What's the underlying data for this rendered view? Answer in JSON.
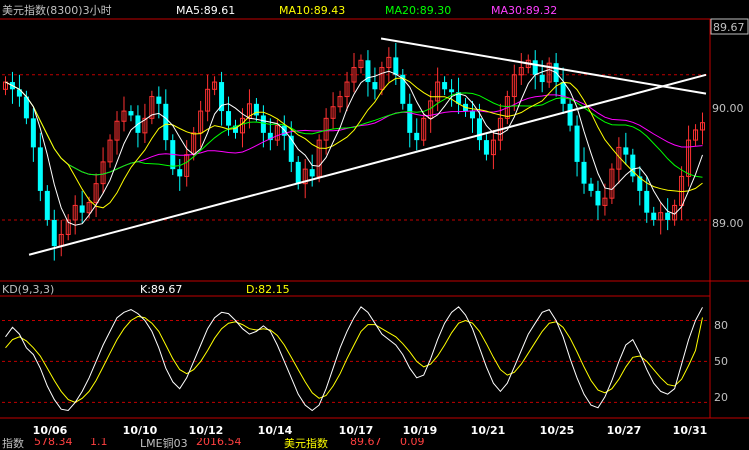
{
  "main_panel": {
    "title": "美元指数(8300)3小时",
    "ma5_label": "MA5:89.61",
    "ma10_label": "MA10:89.43",
    "ma20_label": "MA20:89.30",
    "ma30_label": "MA30:89.32",
    "last_price_tag": "89.67",
    "price_ticks": [
      "90.00",
      "89.00"
    ]
  },
  "kd_panel": {
    "title": "KD(9,3,3)",
    "k_label": "K:89.67",
    "d_label": "D:82.15",
    "ticks": [
      "80",
      "50",
      "20"
    ]
  },
  "x_axis": {
    "dates": [
      "10/06",
      "10/10",
      "10/12",
      "10/14",
      "10/17",
      "10/19",
      "10/21",
      "10/25",
      "10/27",
      "10/31"
    ]
  },
  "status_bar": {
    "item1": "指数",
    "item2": "578.34",
    "item3": "1.1",
    "item4": "LME铜03",
    "item5": "2016.54",
    "item6": "美元指数",
    "item7": "89.67",
    "item8": "0.09"
  },
  "colors": {
    "background": "#000000",
    "up_candle": "#ff3232",
    "down_candle": "#00ffff",
    "ma5": "#ffffff",
    "ma10": "#ffff00",
    "ma20": "#00ff00",
    "ma30": "#ff00ff",
    "grid": "#c00000",
    "k_line": "#ffffff",
    "d_line": "#ffff00"
  },
  "chart_data": {
    "type": "candlestick",
    "x_range": [
      "10/05",
      "10/31"
    ],
    "ylim": [
      88.6,
      90.35
    ],
    "kd_ylim": [
      10,
      95
    ],
    "price_gridlines": [
      90.0,
      89.0
    ],
    "kd_gridlines": [
      80,
      50,
      20
    ],
    "moving_averages": [
      "MA5",
      "MA10",
      "MA20",
      "MA30"
    ],
    "trendlines": [
      {
        "from": [
          "10/06",
          88.76
        ],
        "to": [
          "10/31",
          90.0
        ]
      },
      {
        "from": [
          "10/19",
          90.25
        ],
        "to": [
          "10/31",
          89.87
        ]
      }
    ],
    "close_series": [
      89.95,
      89.9,
      89.85,
      89.7,
      89.5,
      89.2,
      89.0,
      88.82,
      88.9,
      89.0,
      89.1,
      89.05,
      89.12,
      89.25,
      89.4,
      89.55,
      89.68,
      89.75,
      89.72,
      89.6,
      89.7,
      89.85,
      89.8,
      89.55,
      89.35,
      89.3,
      89.45,
      89.6,
      89.75,
      89.9,
      89.95,
      89.75,
      89.65,
      89.6,
      89.7,
      89.8,
      89.72,
      89.6,
      89.55,
      89.65,
      89.58,
      89.4,
      89.25,
      89.35,
      89.3,
      89.55,
      89.7,
      89.78,
      89.85,
      89.95,
      90.05,
      90.1,
      89.95,
      89.9,
      90.05,
      90.12,
      90.0,
      89.8,
      89.6,
      89.55,
      89.7,
      89.82,
      89.95,
      89.9,
      89.88,
      89.8,
      89.75,
      89.7,
      89.55,
      89.45,
      89.55,
      89.7,
      89.85,
      90.0,
      90.05,
      90.1,
      90.0,
      89.95,
      90.08,
      89.95,
      89.8,
      89.65,
      89.4,
      89.25,
      89.2,
      89.1,
      89.15,
      89.35,
      89.5,
      89.45,
      89.3,
      89.2,
      89.05,
      89.0,
      89.05,
      89.0,
      89.1,
      89.3,
      89.55,
      89.62,
      89.67
    ],
    "k_series": [
      68,
      75,
      70,
      60,
      55,
      45,
      32,
      22,
      15,
      14,
      20,
      28,
      38,
      50,
      62,
      72,
      82,
      86,
      88,
      85,
      80,
      72,
      60,
      45,
      35,
      30,
      38,
      50,
      62,
      74,
      82,
      86,
      85,
      80,
      74,
      70,
      72,
      76,
      72,
      62,
      50,
      38,
      26,
      18,
      14,
      18,
      30,
      45,
      60,
      72,
      82,
      90,
      86,
      78,
      70,
      66,
      62,
      55,
      45,
      38,
      40,
      52,
      66,
      78,
      86,
      90,
      84,
      74,
      60,
      46,
      34,
      28,
      34,
      46,
      58,
      70,
      78,
      86,
      88,
      80,
      68,
      52,
      38,
      26,
      18,
      16,
      24,
      36,
      50,
      62,
      66,
      56,
      44,
      34,
      28,
      26,
      30,
      48,
      66,
      80,
      89.67
    ],
    "d_series": [
      60,
      66,
      68,
      65,
      60,
      54,
      45,
      36,
      28,
      22,
      20,
      23,
      28,
      36,
      46,
      56,
      66,
      74,
      80,
      83,
      82,
      78,
      72,
      62,
      52,
      44,
      41,
      44,
      50,
      58,
      67,
      74,
      78,
      79,
      77,
      74,
      73,
      74,
      73,
      69,
      62,
      53,
      44,
      35,
      27,
      23,
      25,
      32,
      41,
      52,
      62,
      72,
      77,
      77,
      74,
      71,
      68,
      63,
      57,
      50,
      46,
      48,
      54,
      62,
      71,
      78,
      80,
      78,
      72,
      63,
      53,
      44,
      40,
      42,
      48,
      56,
      64,
      72,
      78,
      79,
      75,
      67,
      57,
      46,
      36,
      29,
      27,
      30,
      37,
      46,
      53,
      54,
      50,
      44,
      38,
      33,
      32,
      37,
      47,
      58,
      82.15
    ]
  }
}
